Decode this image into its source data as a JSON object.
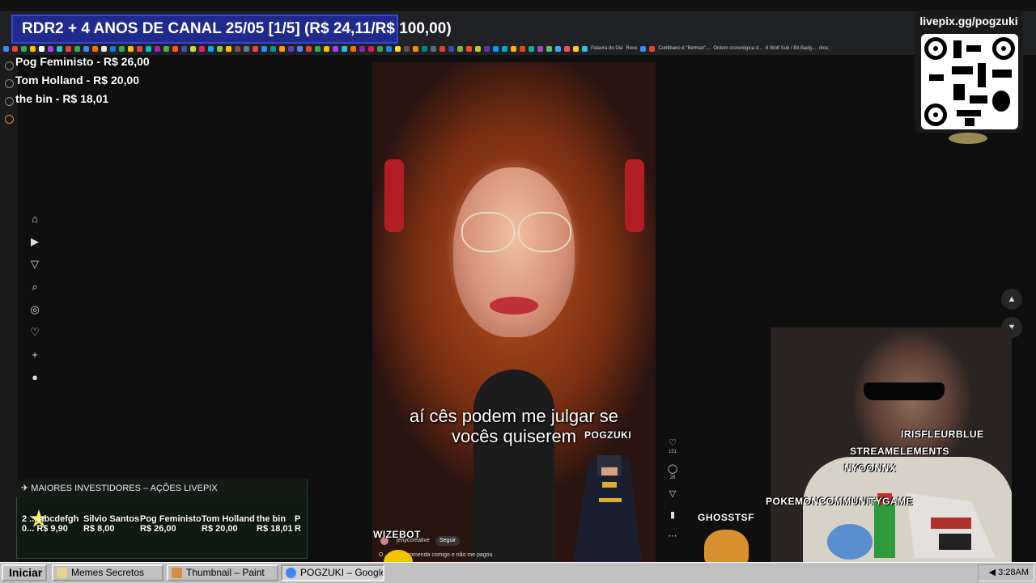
{
  "goal_banner": {
    "text": "RDR2 + 4 ANOS DE CANAL 25/05 [1/5] (R$ 24,11/R$ 100,00)"
  },
  "recent_donors": [
    {
      "text": "Pog Feministo - R$ 26,00"
    },
    {
      "text": "Tom Holland - R$ 20,00"
    },
    {
      "text": "the bin - R$ 18,01"
    }
  ],
  "qr": {
    "title": "livepix.gg/pogzuki"
  },
  "bookmarks": {
    "items": [
      "Palavra do Dia",
      "Roxo",
      "Curitibano é \"Betman\"...",
      "Ordem cronológica d...",
      "6 Wolf Sub / Bit Badg...",
      "ritos"
    ]
  },
  "video": {
    "subtitle_line1": "aí cês podem me julgar se",
    "subtitle_line2": "vocês quiserem",
    "creator": "jenyccreative",
    "follow_label": "Seguir",
    "caption": "O ... ma encomenda comigo e não me pagou",
    "like_count": "151",
    "comment_count": "28"
  },
  "chat_overlay": {
    "names": [
      "POGZUKI",
      "IRISFLEURBLUE",
      "STREAMELEMENTS",
      "NYOONNX",
      "POKEMONCOMMUNITYGAME",
      "GHOSSTSF",
      "WIZEBOT"
    ]
  },
  "investors": {
    "title": "MAIORES INVESTIDORES – AÇÕES LIVEPIX",
    "entries": [
      {
        "name": "2 ... abcdefgh",
        "amount": "0... R$ 9,90"
      },
      {
        "name": "Silvio Santos",
        "amount": "R$ 8,00"
      },
      {
        "name": "Pog Feministo",
        "amount": "R$ 26,00"
      },
      {
        "name": "Tom Holland",
        "amount": "R$ 20,00"
      },
      {
        "name": "the bin",
        "amount": "R$ 18,01"
      },
      {
        "name": "P",
        "amount": "R"
      }
    ]
  },
  "taskbar": {
    "start_label": "Iniciar",
    "tasks": [
      {
        "label": "Memes Secretos"
      },
      {
        "label": "Thumbnail – Paint"
      },
      {
        "label": "POGZUKI – Google"
      }
    ],
    "clock": "3:28AM"
  },
  "colors": {
    "banner_bg": "#1f2a8c",
    "banner_border": "#3944d8",
    "taskbar": "#c0c0c0",
    "page_bg": "#0f0f0f"
  }
}
